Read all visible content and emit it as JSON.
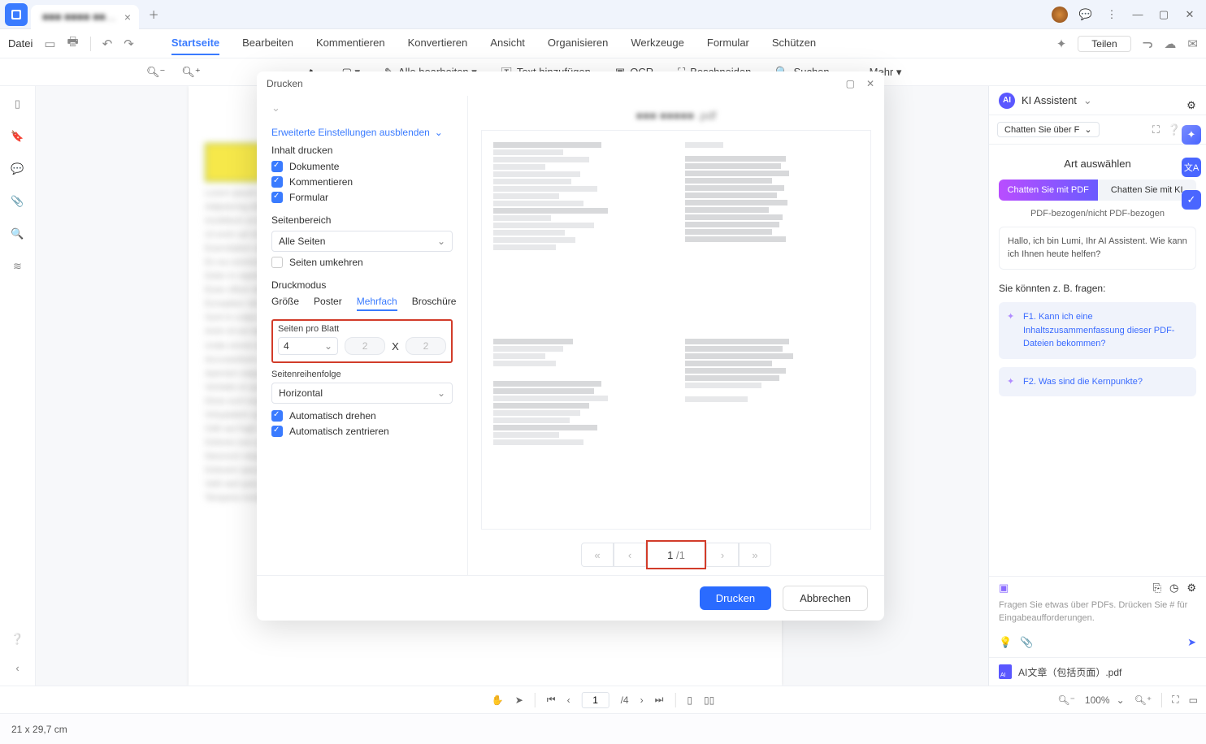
{
  "titlebar": {
    "filename": "■■■ ■■■■ ■■…"
  },
  "menubar": {
    "file": "Datei",
    "tabs": [
      "Startseite",
      "Bearbeiten",
      "Kommentieren",
      "Konvertieren",
      "Ansicht",
      "Organisieren",
      "Werkzeuge",
      "Formular",
      "Schützen"
    ],
    "share": "Teilen"
  },
  "toolbar2": {
    "edit_all": "Alle bearbeiten ▾",
    "add_text": "Text hinzufügen",
    "ocr": "OCR",
    "crop": "Beschneiden",
    "search": "Suchen",
    "more": "Mehr ▾"
  },
  "dialog": {
    "title": "Drucken",
    "link": "Erweiterte Einstellungen ausblenden",
    "content_title": "Inhalt drucken",
    "chk_doc": "Dokumente",
    "chk_comm": "Kommentieren",
    "chk_form": "Formular",
    "range_title": "Seitenbereich",
    "range_sel": "Alle Seiten",
    "reverse": "Seiten umkehren",
    "mode_title": "Druckmodus",
    "mode_tabs": [
      "Größe",
      "Poster",
      "Mehrfach",
      "Broschüre"
    ],
    "spb_label": "Seiten pro Blatt",
    "spb_val": "4",
    "grid_a": "2",
    "grid_b": "2",
    "order_title": "Seitenreihenfolge",
    "order_sel": "Horizontal",
    "auto_rotate": "Automatisch drehen",
    "auto_center": "Automatisch zentrieren",
    "preview_title": "■■■ ■■■■■ .pdf",
    "page_current": "1",
    "page_total": "/1",
    "print_btn": "Drucken",
    "cancel_btn": "Abbrechen"
  },
  "ai": {
    "title": "KI Assistent",
    "dropdown": "Chatten Sie über F",
    "section": "Art auswählen",
    "pill_a": "Chatten Sie mit PDF",
    "pill_b": "Chatten Sie mit KI",
    "caption": "PDF-bezogen/nicht PDF-bezogen",
    "greeting": "Hallo, ich bin Lumi, Ihr AI Assistent. Wie kann ich Ihnen heute helfen?",
    "ask_title": "Sie könnten z. B. fragen:",
    "sugg1": "F1. Kann ich eine Inhaltszusammenfassung dieser PDF-Dateien bekommen?",
    "sugg2": "F2. Was sind die Kernpunkte?",
    "placeholder": "Fragen Sie etwas über PDFs. Drücken Sie # für Eingabeaufforderungen.",
    "file": "AI文章（包括页面）.pdf"
  },
  "status": {
    "dim": "21 x 29,7 cm",
    "page_cur": "1",
    "page_tot": "/4",
    "zoom": "100%"
  }
}
